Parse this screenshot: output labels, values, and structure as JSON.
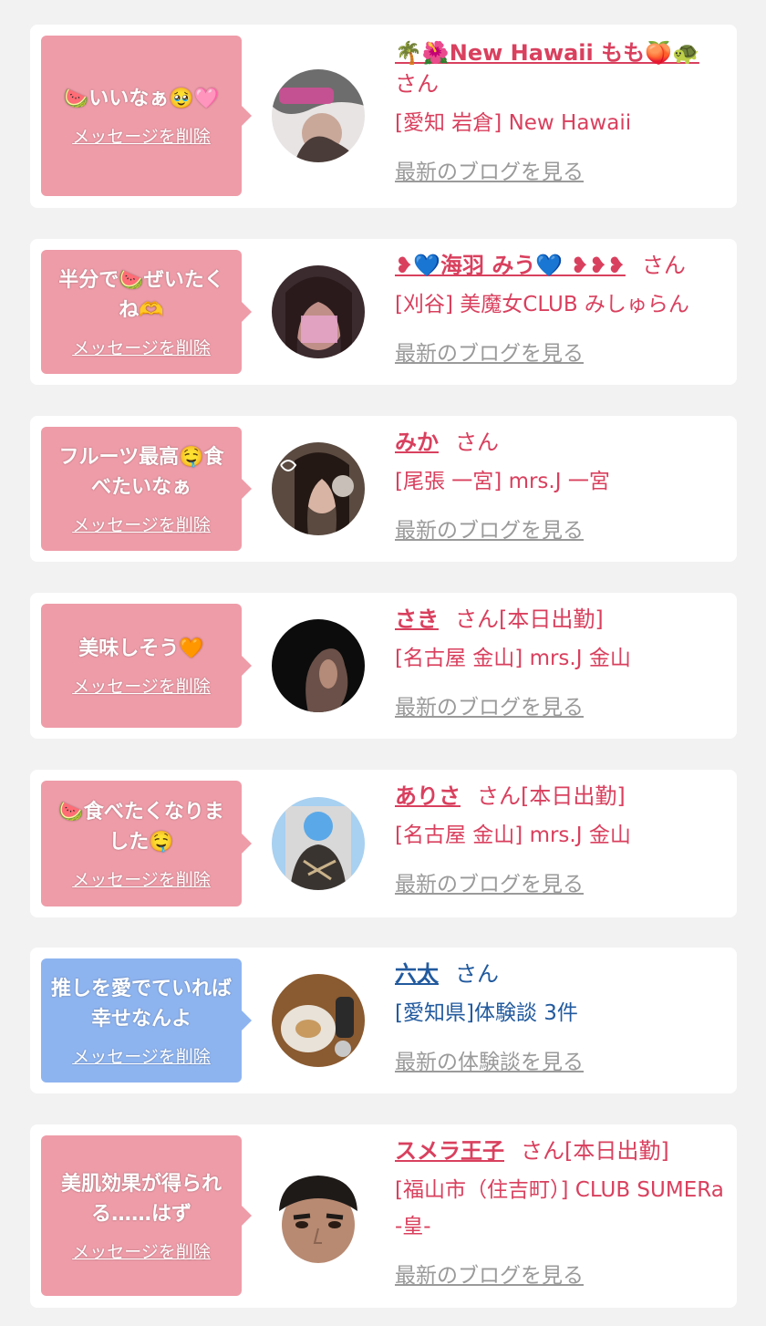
{
  "colors": {
    "page_bg": "#f2f2f2",
    "card_bg": "#ffffff",
    "bubble_pink": "#ee9ca8",
    "bubble_blue": "#8eb4f0",
    "text_pink": "#d9405e",
    "text_blue": "#225a9e",
    "link_gray": "#9a9a9a"
  },
  "messages": [
    {
      "message": "🍉いいなぁ🥹🩷",
      "delete_label": "メッセージを削除",
      "name": "🌴🌺New Hawaii もも🍑🐢",
      "san": "さん",
      "status": "",
      "shop": "[愛知 岩倉] New Hawaii",
      "blog_label": "最新のブログを見る",
      "avatar_icon": "girl-photo-avatar-icon"
    },
    {
      "message": "半分で🍉ぜいたくね🫶",
      "delete_label": "メッセージを削除",
      "name": "❥💙海羽 みう💙 ❥❥❥",
      "san": "さん",
      "status": "",
      "shop": "[刈谷] 美魔女CLUB みしゅらん",
      "blog_label": "最新のブログを見る",
      "avatar_icon": "girl-photo-avatar-icon"
    },
    {
      "message": "フルーツ最高🤤食べたいなぁ",
      "delete_label": "メッセージを削除",
      "name": "みか",
      "san": "さん",
      "status": "",
      "shop": "[尾張 一宮] mrs.J 一宮",
      "blog_label": "最新のブログを見る",
      "avatar_icon": "girl-photo-avatar-icon"
    },
    {
      "message": "美味しそう🧡",
      "delete_label": "メッセージを削除",
      "name": "さき",
      "san": "さん",
      "status": "[本日出勤]",
      "shop": "[名古屋 金山] mrs.J 金山",
      "blog_label": "最新のブログを見る",
      "avatar_icon": "girl-photo-avatar-icon"
    },
    {
      "message": "🍉食べたくなりました🤤",
      "delete_label": "メッセージを削除",
      "name": "ありさ",
      "san": "さん",
      "status": "[本日出勤]",
      "shop": "[名古屋 金山] mrs.J 金山",
      "blog_label": "最新のブログを見る",
      "avatar_icon": "girl-photo-avatar-icon"
    },
    {
      "message": "推しを愛でていれば幸せなんよ",
      "delete_label": "メッセージを削除",
      "name": "六太",
      "san": "さん",
      "status": "",
      "shop": "[愛知県]体験談 3件",
      "blog_label": "最新の体験談を見る",
      "avatar_icon": "food-photo-avatar-icon"
    },
    {
      "message": "美肌効果が得られる……はず",
      "delete_label": "メッセージを削除",
      "name": "スメラ王子",
      "san": "さん",
      "status": "[本日出勤]",
      "shop": "[福山市（住吉町）] CLUB SUMERa -皇-",
      "blog_label": "最新のブログを見る",
      "avatar_icon": "man-face-avatar-icon"
    }
  ]
}
